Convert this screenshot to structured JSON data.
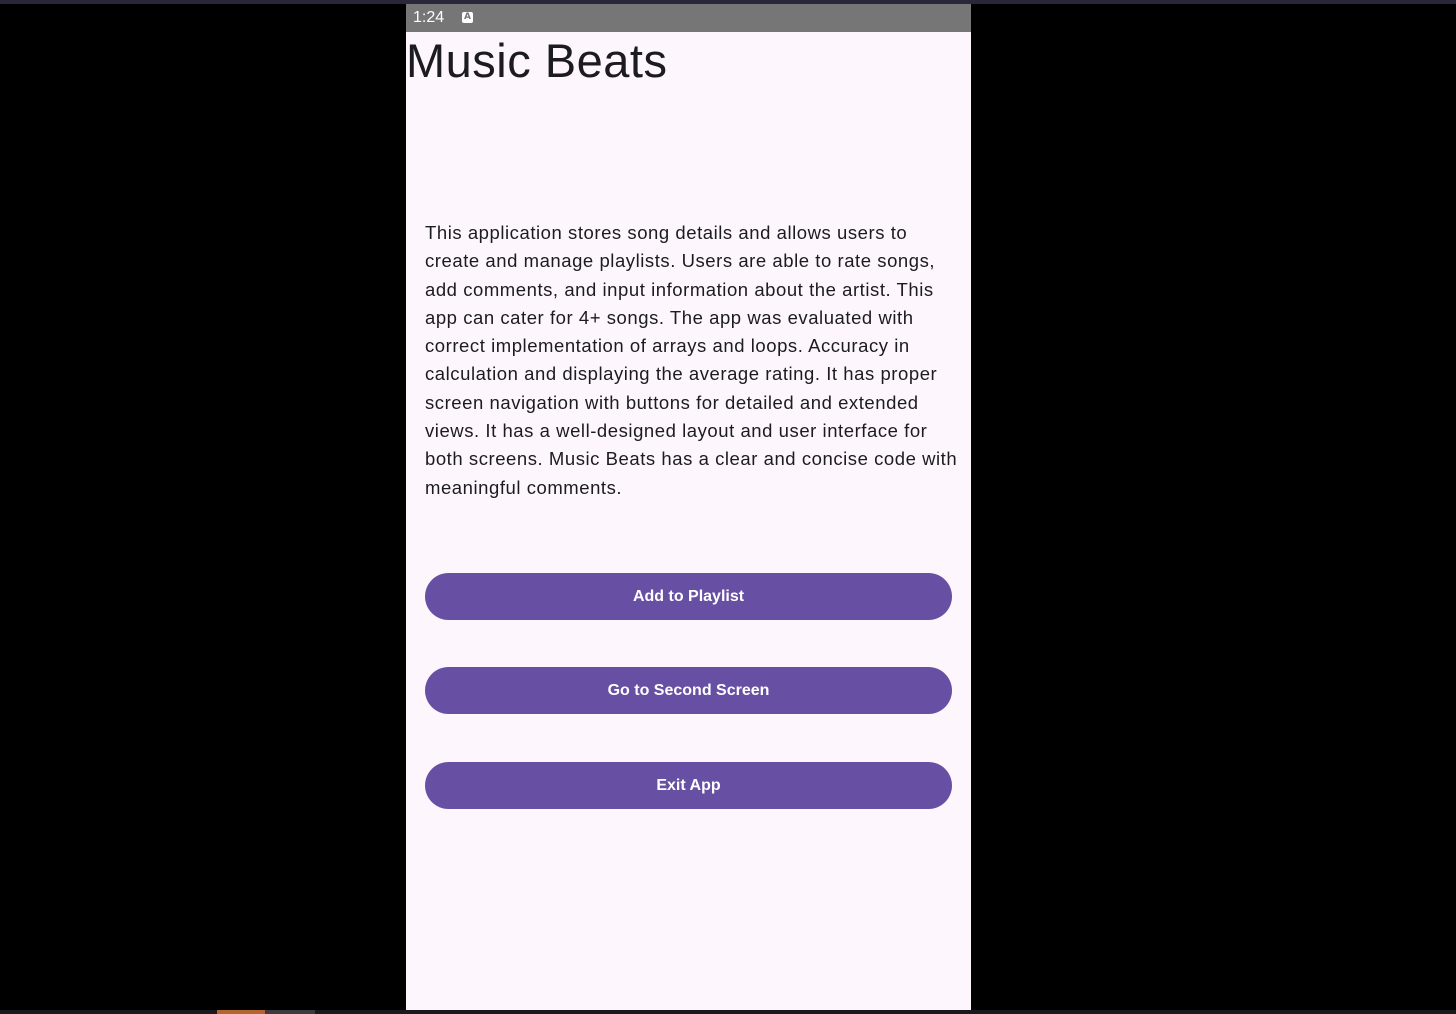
{
  "status_bar": {
    "time": "1:24",
    "notification_icon": "A"
  },
  "app": {
    "title": "Music Beats",
    "description": "This application stores song details and allows users to create and manage playlists. Users are able to rate songs, add comments, and input information about the artist. This app can cater for 4+ songs. The app was evaluated with correct implementation of arrays and loops. Accuracy in calculation and displaying the average rating. It has proper screen navigation with buttons for detailed and extended views. It has a well-designed layout and user interface for both screens. Music Beats has a clear and concise code with meaningful comments."
  },
  "buttons": {
    "add_to_playlist": "Add to Playlist",
    "go_to_second_screen": "Go to Second Screen",
    "exit_app": "Exit App"
  },
  "colors": {
    "primary": "#6750a4",
    "background": "#fdf7fd",
    "status_bar": "#767676",
    "text": "#1c1b1f"
  }
}
